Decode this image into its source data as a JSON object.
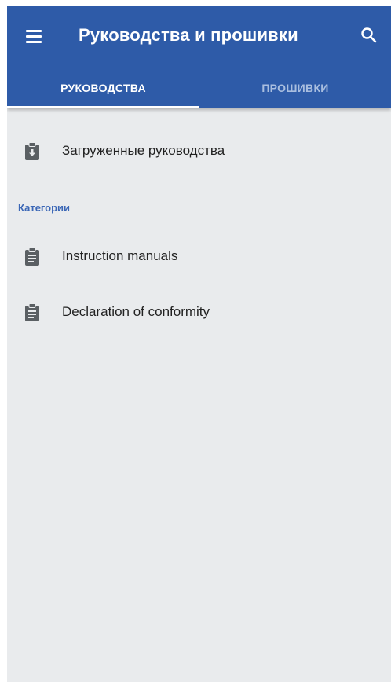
{
  "appbar": {
    "title": "Руководства и прошивки",
    "menu_icon": "hamburger-menu-icon",
    "search_icon": "search-icon",
    "background_color": "#2e5ba8"
  },
  "tabs": [
    {
      "label": "РУКОВОДСТВА",
      "active": true
    },
    {
      "label": "ПРОШИВКИ",
      "active": false
    }
  ],
  "downloaded": {
    "label": "Загруженные руководства",
    "icon": "clipboard-download-icon"
  },
  "categories": {
    "header": "Категории",
    "items": [
      {
        "label": "Instruction manuals",
        "icon": "clipboard-text-icon"
      },
      {
        "label": "Declaration of conformity",
        "icon": "clipboard-text-icon"
      }
    ]
  }
}
